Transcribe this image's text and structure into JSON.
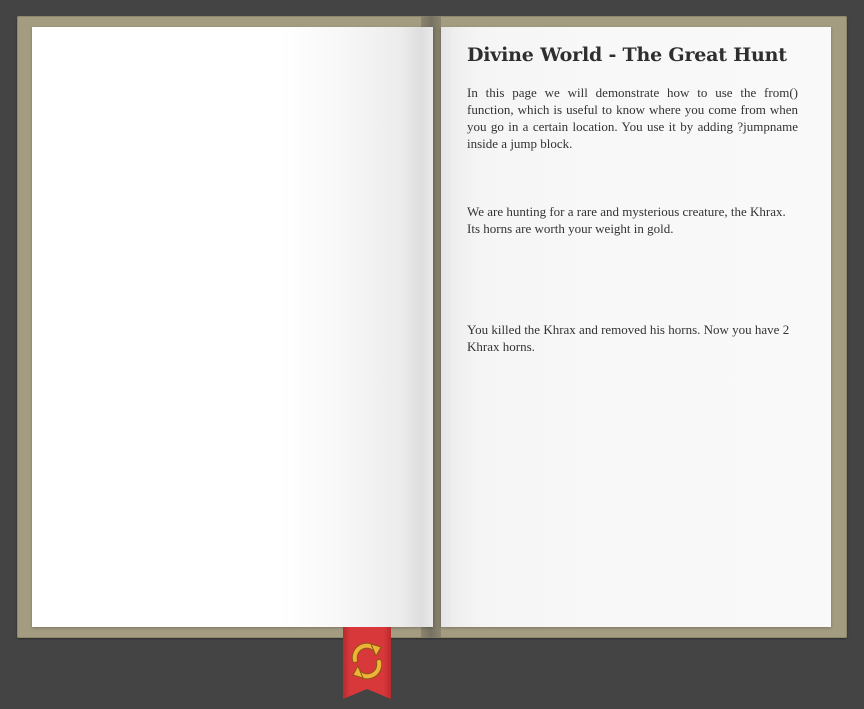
{
  "book": {
    "right_page": {
      "title": "Divine World - The Great Hunt",
      "paragraphs": [
        "In this page we will demonstrate how to use the from() function, which is useful to know where you come from when you go in a certain location. You use it by adding ?jumpname inside a jump block.",
        "We are hunting for a rare and mysterious creature, the Khrax. Its horns are worth your weight in gold.",
        "You killed the Khrax and removed his horns. Now you have 2 Khrax horns."
      ]
    }
  },
  "bookmark": {
    "icon": "refresh-icon",
    "colors": {
      "ribbon": "#d8383a",
      "icon": "#f0b33a"
    }
  },
  "colors": {
    "background": "#444444",
    "cover": "#a49c80",
    "text": "#333333"
  }
}
